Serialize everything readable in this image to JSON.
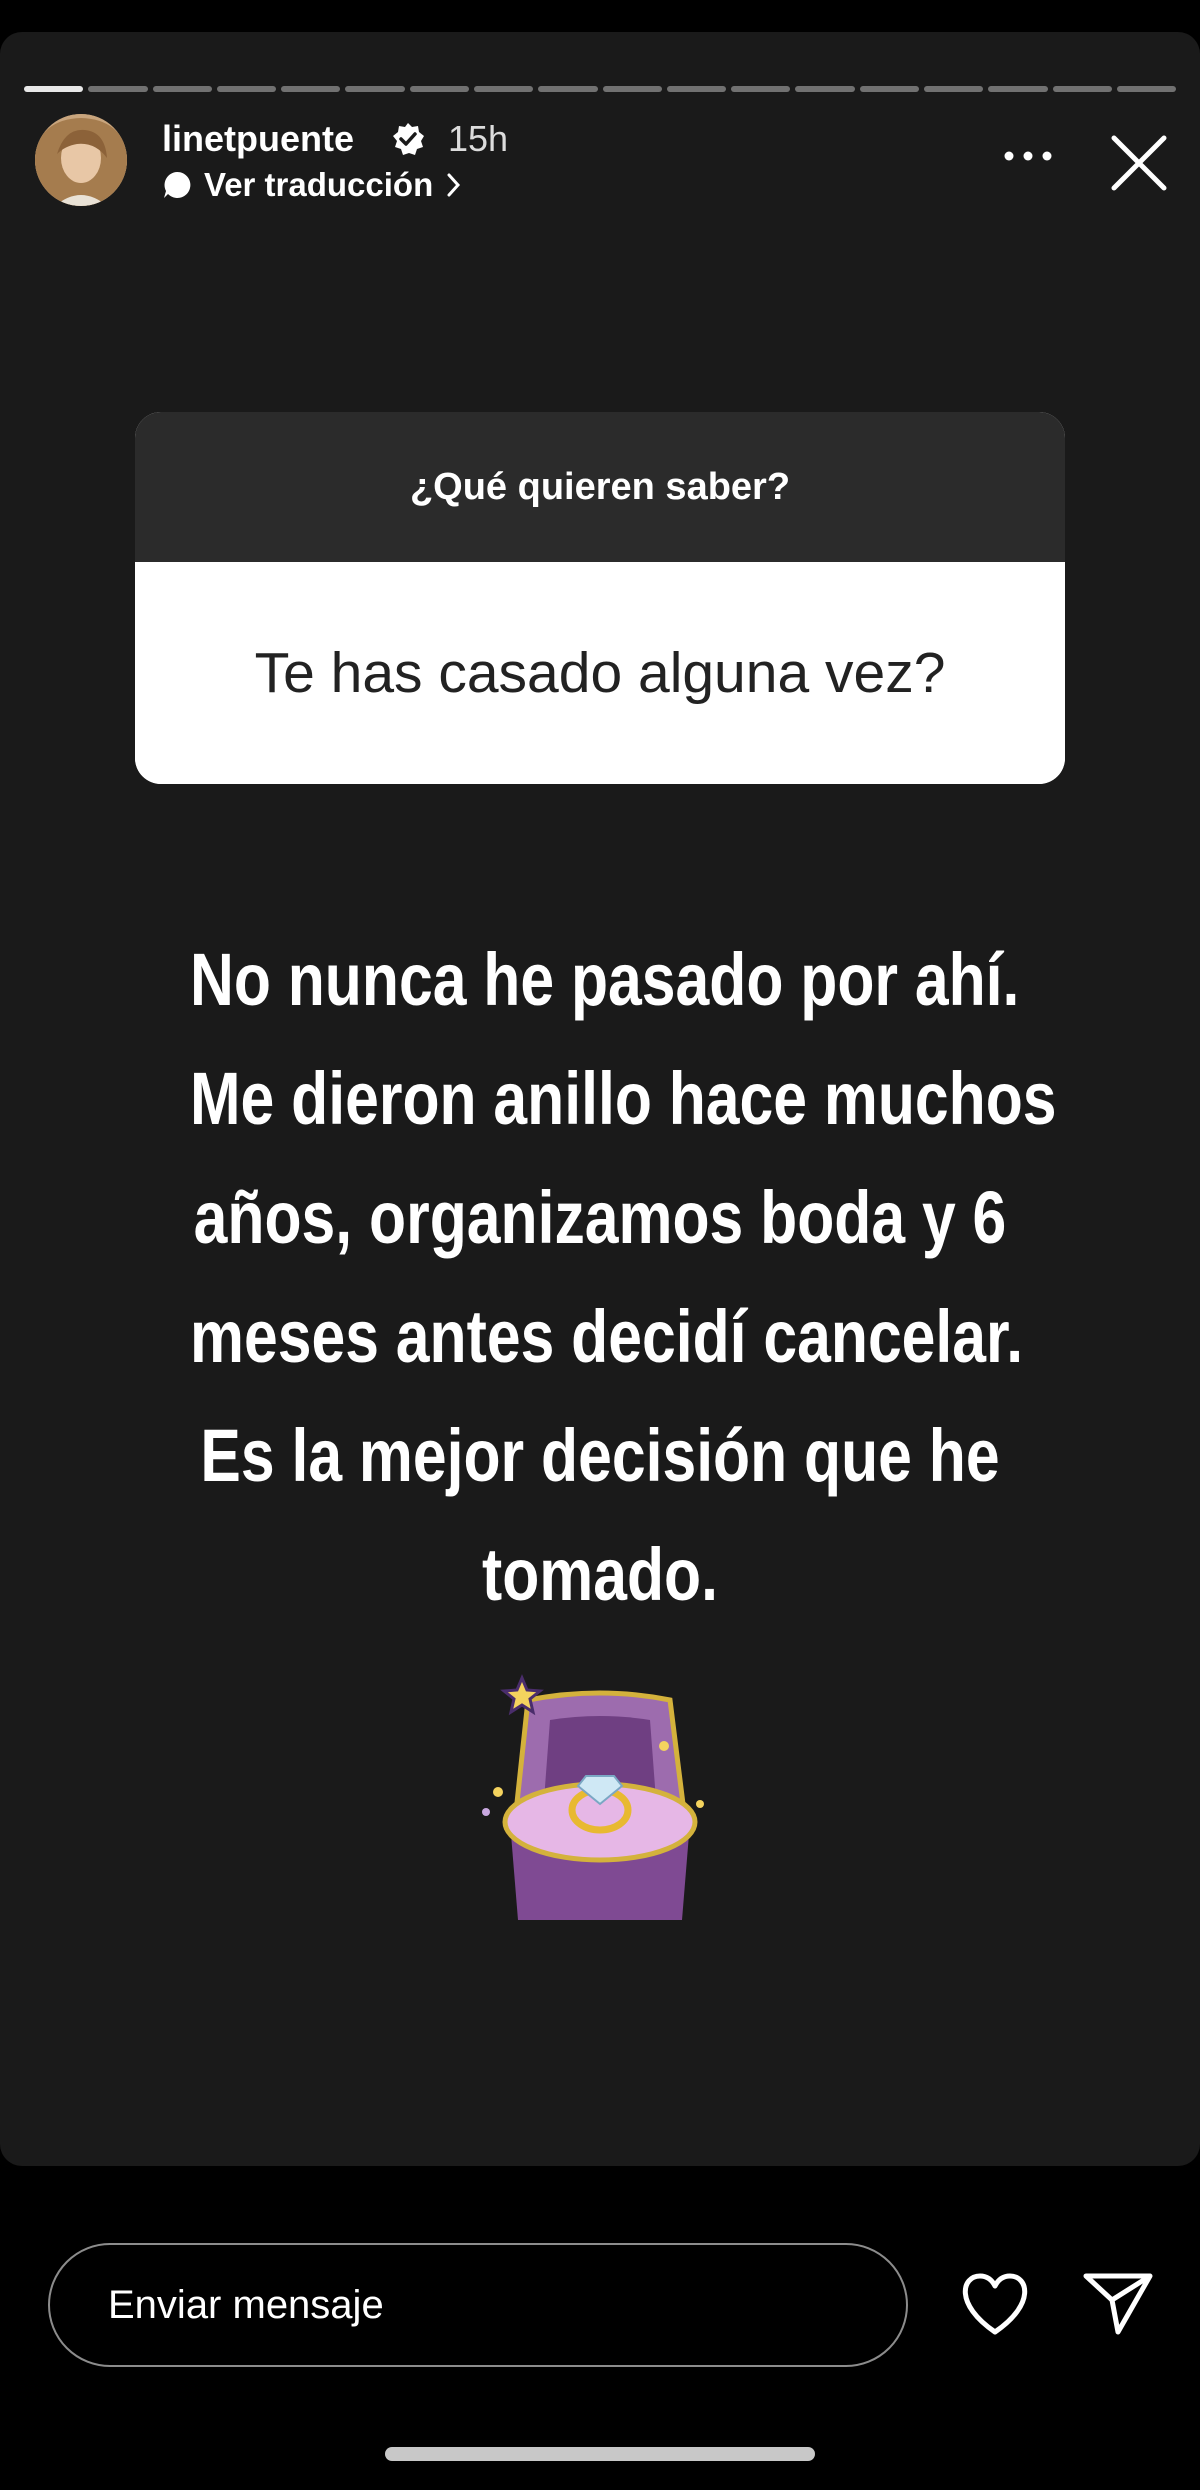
{
  "header": {
    "username": "linetpuente",
    "time": "15h",
    "translation": "Ver traducción"
  },
  "question": {
    "prompt": "¿Qué quieren saber?",
    "text": "Te has casado alguna vez?"
  },
  "answer": {
    "lines": [
      "No nunca he pasado por ahí.",
      "Me dieron anillo hace muchos",
      "años, organizamos boda y 6",
      "meses antes decidí cancelar.",
      "Es la mejor decisión que he",
      "tomado."
    ]
  },
  "footer": {
    "message_placeholder": "Enviar mensaje"
  },
  "progress": {
    "segments": 18,
    "active": 1
  },
  "colors": {
    "background": "#1a1a1a",
    "accent": "#ffffff",
    "ring_box": "#8e5aa0"
  }
}
